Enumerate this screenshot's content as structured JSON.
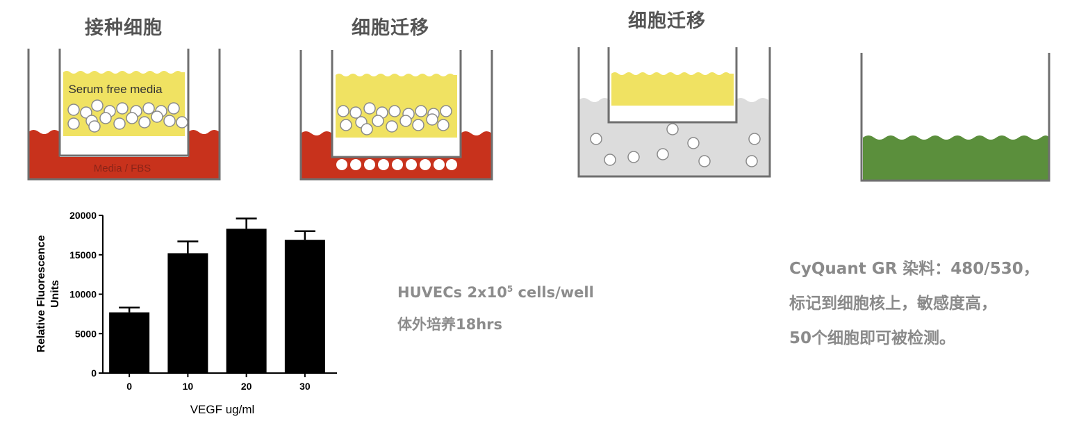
{
  "panels": [
    {
      "title": "接种细胞",
      "upper_label": "Serum free media",
      "lower_label": "Media / FBS"
    },
    {
      "title": "细胞迁移"
    },
    {
      "title": "细胞迁移"
    },
    {
      "title": ""
    }
  ],
  "colors": {
    "serum_free_media": "#f0e262",
    "media_fbs": "#c8321c",
    "post_migration_buffer": "#dcdcdc",
    "cyquant_dye": "#5b8f3c",
    "well_wall": "#6f6f6f",
    "cell_fill": "#ffffff",
    "title_text": "#555555",
    "caption_text": "#8c8c8c"
  },
  "caption_left": {
    "line1_prefix": "HUVECs 2x10",
    "line1_sup": "5",
    "line1_suffix": " cells/well",
    "line2": "体外培养18hrs"
  },
  "caption_right": {
    "line1": "CyQuant GR 染料：480/530，",
    "line2": "标记到细胞核上，敏感度高，",
    "line3": "50个细胞即可被检测。"
  },
  "chart_data": {
    "type": "bar",
    "categories": [
      "0",
      "10",
      "20",
      "30"
    ],
    "values": [
      7700,
      15200,
      18300,
      16900
    ],
    "errors": [
      600,
      1500,
      1300,
      1100
    ],
    "xlabel": "VEGF ug/ml",
    "ylabel": [
      "Relative Fluorescence",
      "Units"
    ],
    "ylim": [
      0,
      20000
    ],
    "yticks": [
      "0",
      "5000",
      "10000",
      "15000",
      "20000"
    ],
    "bar_color": "#000000",
    "grid": false
  }
}
